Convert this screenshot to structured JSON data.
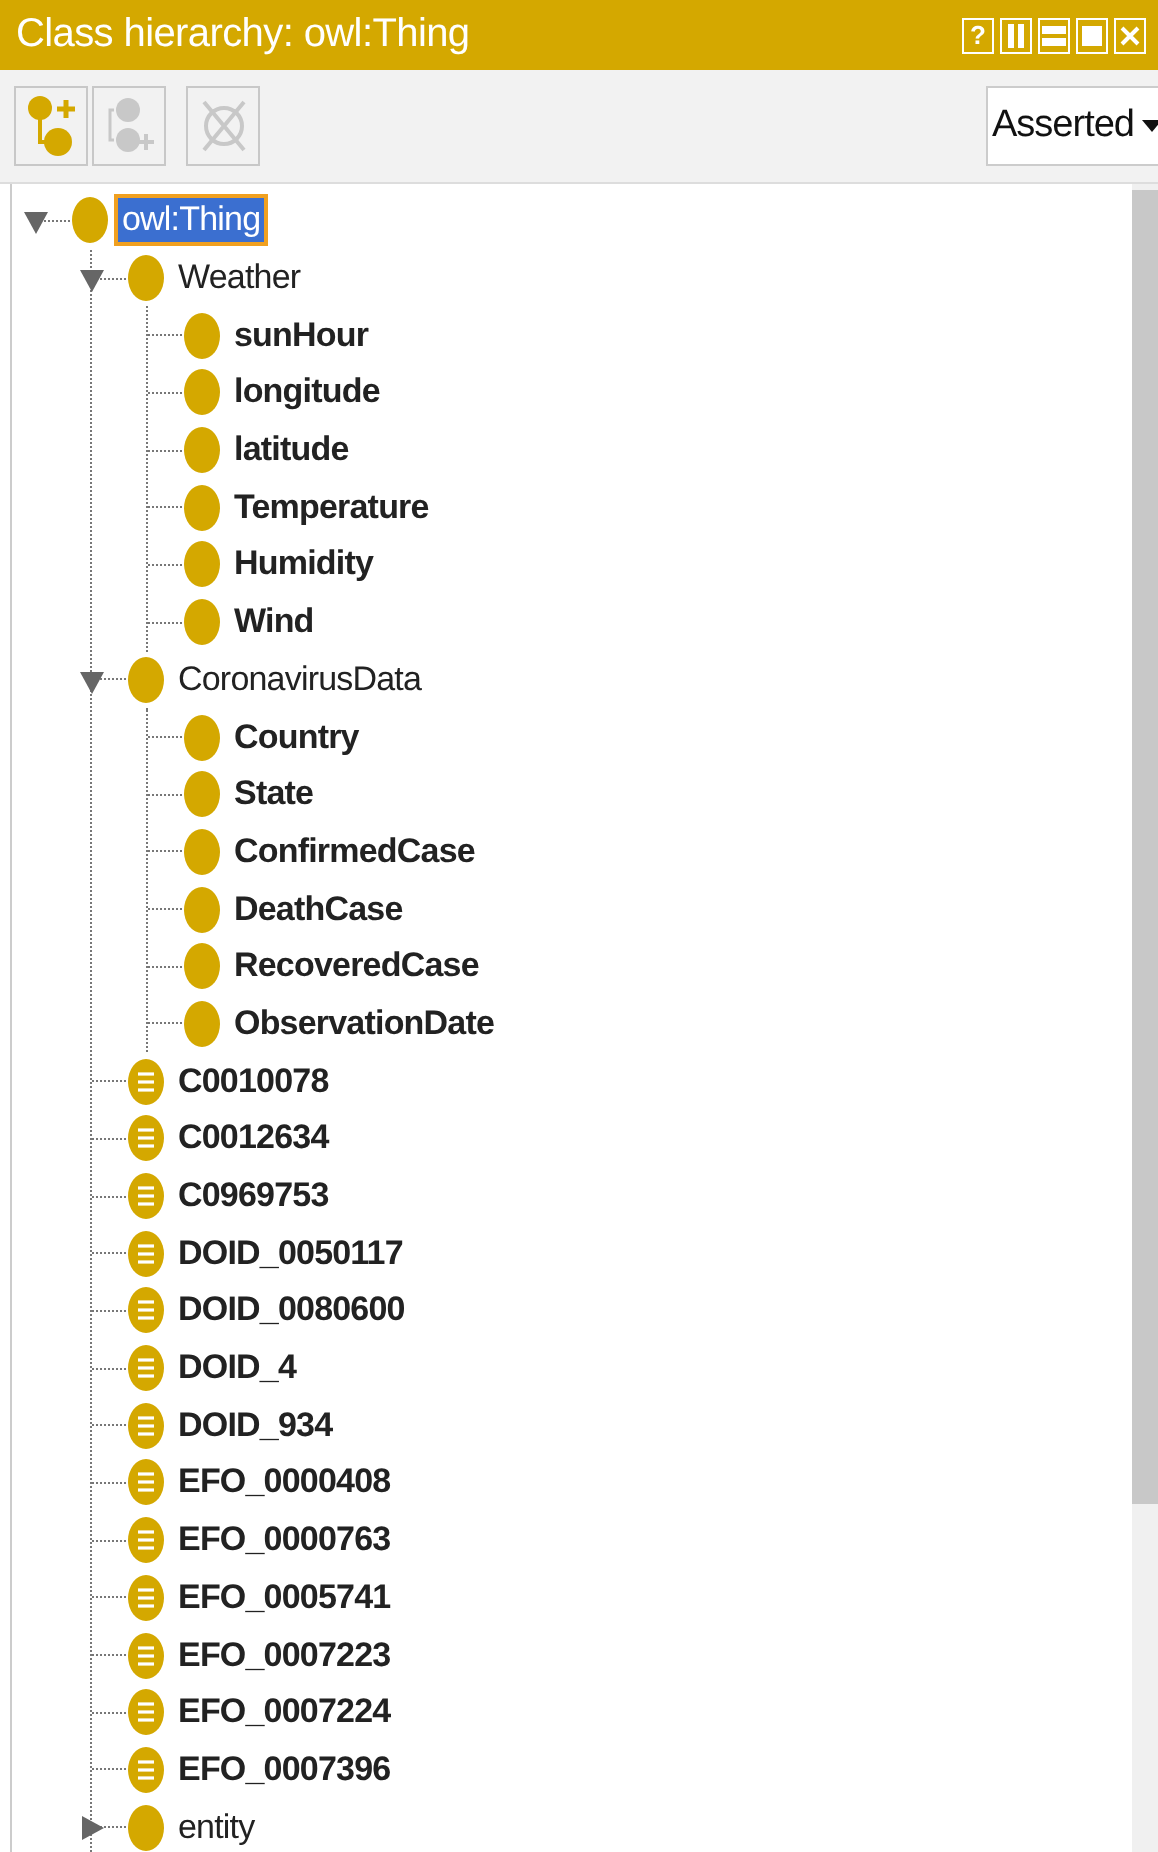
{
  "title_bar": {
    "title": "Class hierarchy: owl:Thing",
    "help_label": "?"
  },
  "toolbar": {
    "buttons": [
      {
        "kind": "add-subclass",
        "disabled": false
      },
      {
        "kind": "add-sibling",
        "disabled": true
      },
      {
        "kind": "delete",
        "disabled": true
      }
    ],
    "view_select": {
      "value": "Asserted"
    }
  },
  "tree": [
    {
      "label": "owl:Thing",
      "kind": "class",
      "bold": false,
      "selected": true,
      "expanded": true,
      "children": [
        {
          "label": "Weather",
          "kind": "class",
          "bold": false,
          "selected": false,
          "expanded": true,
          "children": [
            {
              "label": "sunHour",
              "kind": "class",
              "bold": true,
              "selected": false
            },
            {
              "label": "longitude",
              "kind": "class",
              "bold": true,
              "selected": false
            },
            {
              "label": "latitude",
              "kind": "class",
              "bold": true,
              "selected": false
            },
            {
              "label": "Temperature",
              "kind": "class",
              "bold": true,
              "selected": false
            },
            {
              "label": "Humidity",
              "kind": "class",
              "bold": true,
              "selected": false
            },
            {
              "label": "Wind",
              "kind": "class",
              "bold": true,
              "selected": false
            }
          ]
        },
        {
          "label": "CoronavirusData",
          "kind": "class",
          "bold": false,
          "selected": false,
          "expanded": true,
          "children": [
            {
              "label": "Country",
              "kind": "class",
              "bold": true,
              "selected": false
            },
            {
              "label": "State",
              "kind": "class",
              "bold": true,
              "selected": false
            },
            {
              "label": "ConfirmedCase",
              "kind": "class",
              "bold": true,
              "selected": false
            },
            {
              "label": "DeathCase",
              "kind": "class",
              "bold": true,
              "selected": false
            },
            {
              "label": "RecoveredCase",
              "kind": "class",
              "bold": true,
              "selected": false
            },
            {
              "label": "ObservationDate",
              "kind": "class",
              "bold": true,
              "selected": false
            }
          ]
        },
        {
          "label": "C0010078",
          "kind": "defined",
          "bold": true,
          "selected": false
        },
        {
          "label": "C0012634",
          "kind": "defined",
          "bold": true,
          "selected": false
        },
        {
          "label": "C0969753",
          "kind": "defined",
          "bold": true,
          "selected": false
        },
        {
          "label": "DOID_0050117",
          "kind": "defined",
          "bold": true,
          "selected": false
        },
        {
          "label": "DOID_0080600",
          "kind": "defined",
          "bold": true,
          "selected": false
        },
        {
          "label": "DOID_4",
          "kind": "defined",
          "bold": true,
          "selected": false
        },
        {
          "label": "DOID_934",
          "kind": "defined",
          "bold": true,
          "selected": false
        },
        {
          "label": "EFO_0000408",
          "kind": "defined",
          "bold": true,
          "selected": false
        },
        {
          "label": "EFO_0000763",
          "kind": "defined",
          "bold": true,
          "selected": false
        },
        {
          "label": "EFO_0005741",
          "kind": "defined",
          "bold": true,
          "selected": false
        },
        {
          "label": "EFO_0007223",
          "kind": "defined",
          "bold": true,
          "selected": false
        },
        {
          "label": "EFO_0007224",
          "kind": "defined",
          "bold": true,
          "selected": false
        },
        {
          "label": "EFO_0007396",
          "kind": "defined",
          "bold": true,
          "selected": false
        },
        {
          "label": "entity",
          "kind": "class",
          "bold": false,
          "selected": false,
          "expanded": false
        }
      ]
    }
  ]
}
